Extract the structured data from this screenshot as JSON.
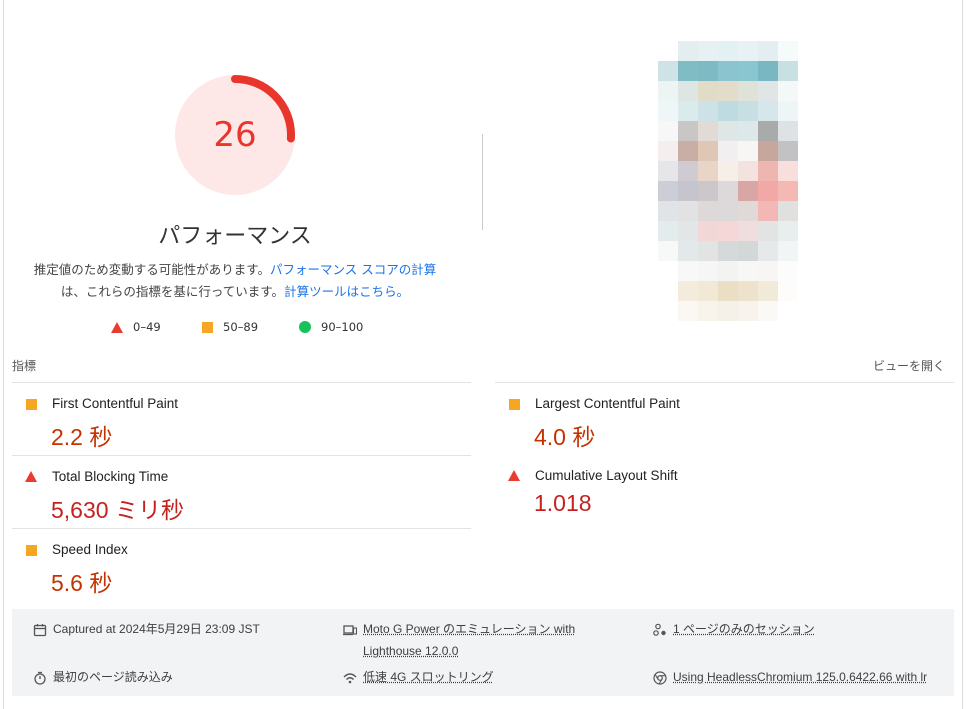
{
  "gauge": {
    "score": "26",
    "score_fraction": 0.26,
    "title": "パフォーマンス",
    "color": "#e8362d",
    "background": "#fde8e7"
  },
  "description": {
    "text1": "推定値のため変動する可能性があります。",
    "link1": "パフォーマンス スコアの計算",
    "text2": "は、これらの指標を基に行っています。",
    "link2": "計算ツールはこちら。"
  },
  "legend": [
    {
      "shape": "triangle",
      "range": "0–49",
      "color": "#eb3a31"
    },
    {
      "shape": "square",
      "range": "50–89",
      "color": "#f5a623"
    },
    {
      "shape": "circle",
      "range": "90–100",
      "color": "#16c35a"
    }
  ],
  "metrics_section": {
    "label": "指標",
    "toggle": "ビューを開く"
  },
  "metrics": [
    {
      "name": "First Contentful Paint",
      "value": "2.2 秒",
      "status": "average"
    },
    {
      "name": "Largest Contentful Paint",
      "value": "4.0 秒",
      "status": "average"
    },
    {
      "name": "Total Blocking Time",
      "value": "5,630 ミリ秒",
      "status": "fail"
    },
    {
      "name": "Cumulative Layout Shift",
      "value": "1.018",
      "status": "fail"
    },
    {
      "name": "Speed Index",
      "value": "5.6 秒",
      "status": "average"
    }
  ],
  "footer": {
    "captured": "Captured at 2024年5月29日 23:09 JST",
    "device": "Moto G Power のエミュレーション with Lighthouse 12.0.0",
    "session": "1 ページのみのセッション",
    "load": "最初のページ読み込み",
    "throttling": "低速 4G スロットリング",
    "browser": "Using HeadlessChromium 125.0.6422.66 with lr"
  },
  "icons": {
    "captured": "calendar-icon",
    "device": "devices-icon",
    "session": "session-icon",
    "load": "timer-icon",
    "throttling": "network-icon",
    "browser": "chrome-icon"
  },
  "thumbnail_colors": [
    [
      "#ffffff",
      "#e3eef0",
      "#e6f1f3",
      "#e3f0f4",
      "#e6f2f5",
      "#e2eef2",
      "#f5fbfb",
      "#ffffff"
    ],
    [
      "#cfe3e6",
      "#7fbcc4",
      "#7dbac4",
      "#8bc4cf",
      "#8ac6d0",
      "#79b7c2",
      "#c9e0e3",
      "#ffffff"
    ],
    [
      "#edf4f4",
      "#dde6e3",
      "#e0dcc8",
      "#e4dccb",
      "#dfe2d7",
      "#dfe6e5",
      "#f5f8f8",
      "#ffffff"
    ],
    [
      "#eff6f7",
      "#d9ebed",
      "#cde2e6",
      "#bddbe0",
      "#c7dfe3",
      "#d5e7ea",
      "#eef5f6",
      "#ffffff"
    ],
    [
      "#f7f7f7",
      "#c9c7c5",
      "#e2dad4",
      "#dfe6e6",
      "#dde8ea",
      "#a9abaa",
      "#dde3e4",
      "#ffffff"
    ],
    [
      "#f4eeee",
      "#c8aea5",
      "#e0c7b5",
      "#f1efef",
      "#f8f6f5",
      "#c7a79c",
      "#c2c2c4",
      "#ffffff"
    ],
    [
      "#e6e6ea",
      "#d0cbd2",
      "#e9d5c7",
      "#f5efe8",
      "#f4e2de",
      "#eeb6b1",
      "#f8dfdc",
      "#ffffff"
    ],
    [
      "#cccdd7",
      "#c6c4cd",
      "#ccc7cb",
      "#ddd9da",
      "#d8a7a5",
      "#f2a8a6",
      "#f4b8b5",
      "#ffffff"
    ],
    [
      "#e0e4e6",
      "#e2e2e2",
      "#ded8d8",
      "#dcd9db",
      "#e1d8d8",
      "#f1b8b6",
      "#e0e0de",
      "#ffffff"
    ],
    [
      "#e4ebec",
      "#e2e6e7",
      "#f1d7d5",
      "#f4d7d6",
      "#efdedd",
      "#e2e4e4",
      "#e8eeee",
      "#ffffff"
    ],
    [
      "#f7f9f9",
      "#e3e9ea",
      "#e2e4e4",
      "#d6d9d9",
      "#d3d7d7",
      "#e5e9e9",
      "#f2f5f5",
      "#ffffff"
    ],
    [
      "#ffffff",
      "#f8f8f8",
      "#f5f6f5",
      "#f3f3f2",
      "#f7f7f6",
      "#f7f6f5",
      "#fcfcfc",
      "#ffffff"
    ],
    [
      "#ffffff",
      "#f3ecdc",
      "#f1e8d6",
      "#eadfc4",
      "#ede3cc",
      "#f2ead9",
      "#fdfcfa",
      "#ffffff"
    ],
    [
      "#ffffff",
      "#fbf8f3",
      "#f8f4ec",
      "#f6f1e8",
      "#f8f4ed",
      "#fbf9f5",
      "#ffffff",
      "#ffffff"
    ]
  ]
}
